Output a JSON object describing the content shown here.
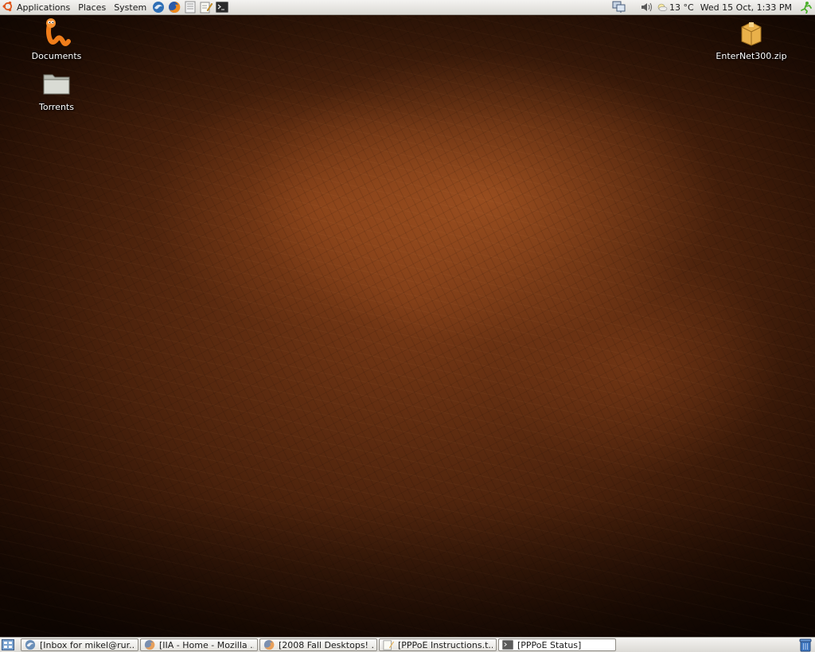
{
  "top_panel": {
    "menus": {
      "applications": "Applications",
      "places": "Places",
      "system": "System"
    },
    "launchers": [
      "thunderbird-icon",
      "firefox-icon",
      "text-document-icon",
      "text-editor-icon",
      "terminal-icon"
    ],
    "tray": {
      "weather": "13 °C",
      "clock": "Wed 15 Oct,  1:33 PM"
    }
  },
  "desktop": {
    "icons": [
      {
        "label": "Documents",
        "icon": "worm-documents-icon"
      },
      {
        "label": "Torrents",
        "icon": "folder-icon"
      },
      {
        "label": "EnterNet300.zip",
        "icon": "archive-icon"
      }
    ]
  },
  "bottom_panel": {
    "tasks": [
      {
        "label": "[Inbox for mikel@rur...",
        "icon": "thunderbird-icon"
      },
      {
        "label": "[IIA - Home - Mozilla ...",
        "icon": "firefox-icon"
      },
      {
        "label": "[2008 Fall Desktops! ...",
        "icon": "firefox-icon"
      },
      {
        "label": "[PPPoE Instructions.t...",
        "icon": "text-editor-icon"
      },
      {
        "label": "[PPPoE Status]",
        "icon": "terminal-icon"
      }
    ]
  },
  "colors": {
    "panel": "#dcdad5",
    "wallpaper": "#4b220c",
    "accent": "#f07d1a"
  }
}
